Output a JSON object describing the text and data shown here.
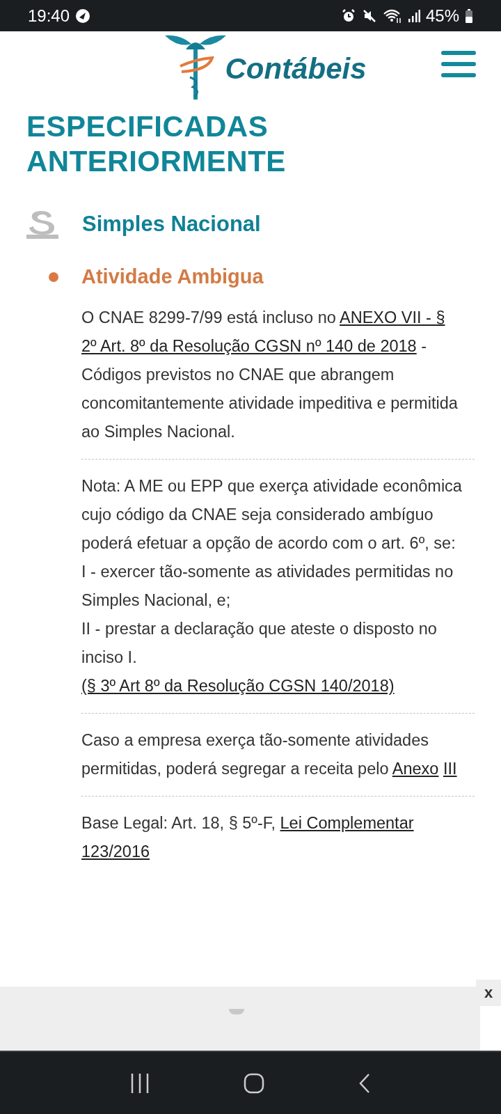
{
  "status_bar": {
    "time": "19:40",
    "battery": "45%"
  },
  "header": {
    "logo_text": "Contábeis"
  },
  "page_heading": [
    "ESPECIFICADAS",
    "ANTERIORMENTE"
  ],
  "section": {
    "title": "Simples Nacional"
  },
  "item": {
    "title": "Atividade Ambigua",
    "blocks": [
      {
        "lines": [
          [
            {
              "kind": "text",
              "text": "O CNAE 8299-7/99 está incluso no"
            },
            {
              "kind": "link",
              "text": "ANEXO VII - §"
            },
            {
              "kind": "link",
              "text": "2º Art. 8º da Resolução CGSN nº 140 de 2018"
            },
            {
              "kind": "text",
              "text": "- Códigos previstos no CNAE que abrangem concomitantemente atividade impeditiva e permitida ao Simples Nacional."
            }
          ]
        ]
      },
      {
        "lines": [
          [
            {
              "kind": "text",
              "text": "Nota: A ME ou EPP que exerça atividade econômica cujo código da CNAE seja considerado ambíguo poderá efetuar a opção de acordo com o art. 6º, se:"
            }
          ],
          [
            {
              "kind": "text",
              "text": "I - exercer tão-somente as atividades permitidas no Simples Nacional, e;"
            }
          ],
          [
            {
              "kind": "text",
              "text": "II - prestar a declaração que ateste o disposto no inciso I."
            }
          ],
          [
            {
              "kind": "link",
              "text": "(§ 3º Art 8º da Resolução CGSN 140/2018)"
            }
          ]
        ]
      },
      {
        "lines": [
          [
            {
              "kind": "text",
              "text": "Caso a empresa exerça tão-somente atividades permitidas, poderá segregar a receita pelo"
            },
            {
              "kind": "link",
              "text": "Anexo"
            },
            {
              "kind": "link",
              "text": "III"
            }
          ]
        ]
      },
      {
        "lines": [
          [
            {
              "kind": "text",
              "text": "Base Legal: Art. 18, § 5º-F,"
            },
            {
              "kind": "link",
              "text": "Lei Complementar"
            },
            {
              "kind": "link",
              "text": "123/2016"
            }
          ]
        ]
      }
    ]
  },
  "ad": {
    "close": "x"
  }
}
